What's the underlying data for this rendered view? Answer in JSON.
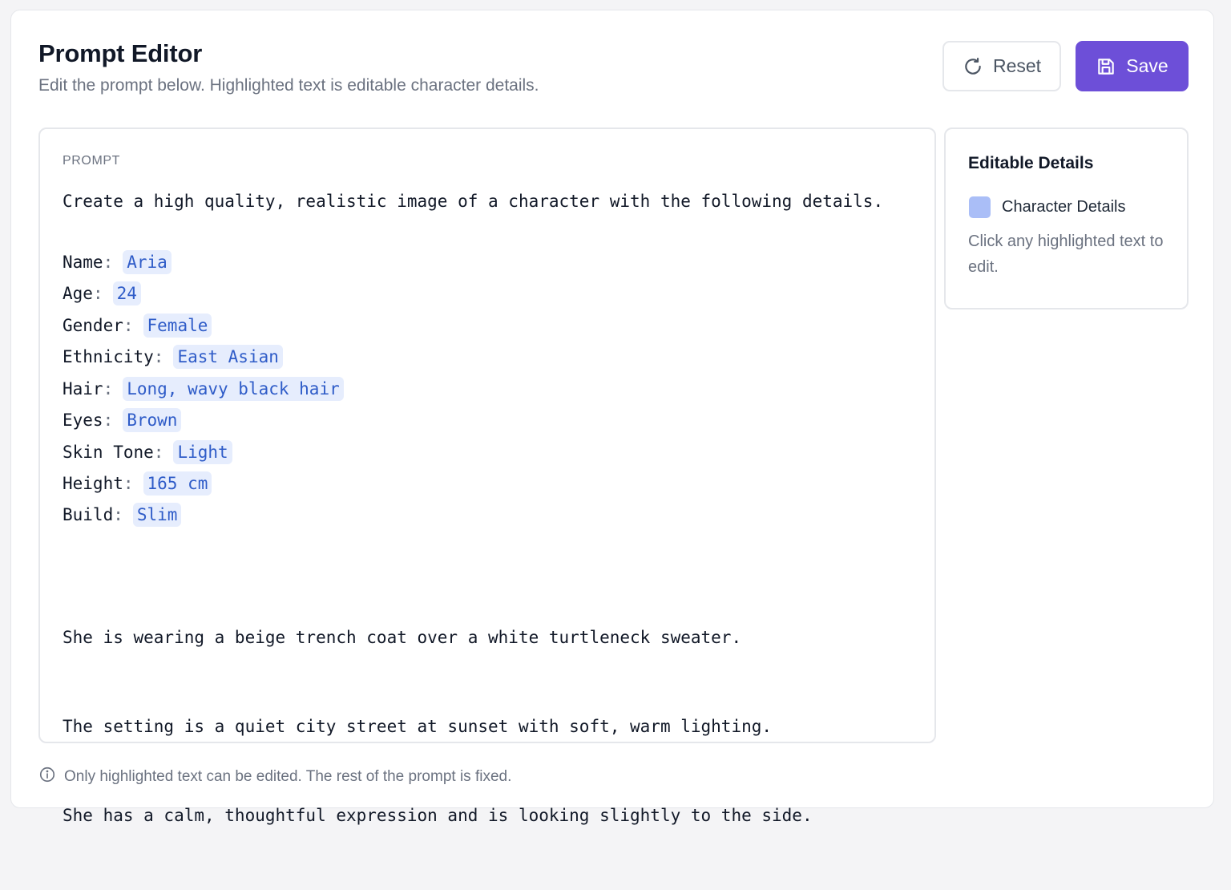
{
  "header": {
    "title": "Prompt Editor",
    "subtitle": "Edit the prompt below. Highlighted text is editable character details."
  },
  "toolbar": {
    "reset_label": "Reset",
    "reset_icon": "refresh-icon",
    "save_label": "Save",
    "save_icon": "floppy-disk-icon",
    "accent_color": "#6d4fd8"
  },
  "prompt": {
    "section_label": "PROMPT",
    "intro": "Create a high quality, realistic image of a character with the following details.",
    "details": [
      {
        "key": "Name",
        "value": "Aria"
      },
      {
        "key": "Age",
        "value": "24"
      },
      {
        "key": "Gender",
        "value": "Female"
      },
      {
        "key": "Ethnicity",
        "value": "East Asian"
      },
      {
        "key": "Hair",
        "value": "Long, wavy black hair"
      },
      {
        "key": "Eyes",
        "value": "Brown"
      },
      {
        "key": "Skin Tone",
        "value": "Light"
      },
      {
        "key": "Height",
        "value": "165 cm"
      },
      {
        "key": "Build",
        "value": "Slim"
      }
    ],
    "outro": [
      "She is wearing a beige trench coat over a white turtleneck sweater.",
      "The setting is a quiet city street at sunset with soft, warm lighting.",
      "She has a calm, thoughtful expression and is looking slightly to the side."
    ],
    "highlight_color": "#e6edfd",
    "highlight_text_color": "#2f5cc8"
  },
  "sidebar": {
    "title": "Editable Details",
    "legend_label": "Character Details",
    "legend_color": "#aabef7",
    "hint": "Click any highlighted text to edit."
  },
  "footer": {
    "icon": "info-icon",
    "note": "Only highlighted text can be edited. The rest of the prompt is fixed."
  }
}
